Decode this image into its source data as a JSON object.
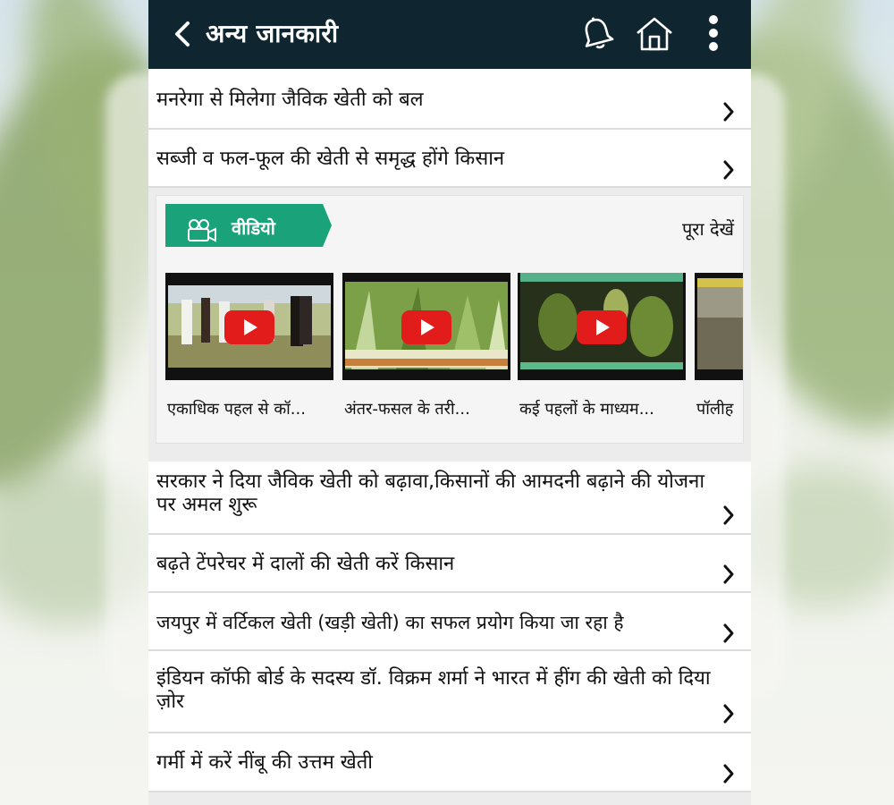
{
  "header": {
    "title": "अन्य जानकारी",
    "icons": [
      "back-icon",
      "bell-icon",
      "home-icon",
      "more-vert-icon"
    ]
  },
  "articles_top": [
    {
      "title": "मनरेगा से मिलेगा जैविक खेती को बल"
    },
    {
      "title": "सब्जी व फल-फूल की खेती से समृद्ध होंगे किसान"
    }
  ],
  "video_section": {
    "tag_label": "वीडियो",
    "see_all": "पूरा देखें",
    "videos": [
      {
        "caption": "एकाधिक पहल से कॉ..."
      },
      {
        "caption": "अंतर-फसल के तरी..."
      },
      {
        "caption": "कई पहलों के माध्यम..."
      },
      {
        "caption": "पॉलीह"
      }
    ]
  },
  "articles_bottom": [
    {
      "title": "सरकार ने दिया जैविक खेती को बढ़ावा,किसानों की आमदनी बढ़ाने की योजना पर अमल शुरू"
    },
    {
      "title": "बढ़ते टेंपरेचर में दालों की खेती करें किसान"
    },
    {
      "title": "जयपुर में वर्टिकल खेती (खड़ी खेती) का सफल प्रयोग किया जा रहा है"
    },
    {
      "title": "इंडियन कॉफी बोर्ड के सदस्य डॉ. विक्रम शर्मा ने भारत में हींग की खेती को दिया ज़ोर"
    },
    {
      "title": "गर्मी में करें नींबू की उत्तम खेती"
    }
  ],
  "colors": {
    "topbar": "#0f2530",
    "video_tag": "#1aa37a",
    "play_button": "#e21b1b",
    "background": "#ececec"
  }
}
